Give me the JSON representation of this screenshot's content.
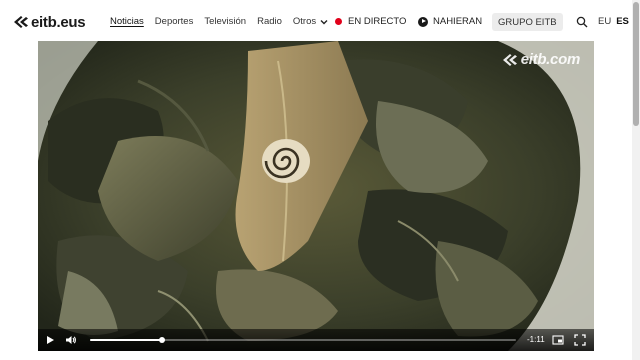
{
  "header": {
    "logo_text": "eitb.eus",
    "nav": [
      {
        "label": "Noticias",
        "active": true
      },
      {
        "label": "Deportes",
        "active": false
      },
      {
        "label": "Televisión",
        "active": false
      },
      {
        "label": "Radio",
        "active": false
      }
    ],
    "more_label": "Otros",
    "live_label": "EN DIRECTO",
    "live_color": "#e1001a",
    "nahieran_label": "NAHIERAN",
    "group_label": "GRUPO EITB",
    "search_icon": "search-icon",
    "languages": [
      {
        "label": "EU",
        "current": false
      },
      {
        "label": "ES",
        "current": true
      }
    ]
  },
  "video": {
    "watermark": "eitb.com",
    "time_remaining": "-1:11",
    "progress_fraction": 0.17,
    "controls": [
      "play-icon",
      "volume-icon",
      "picture-in-picture-icon",
      "fullscreen-icon"
    ]
  }
}
